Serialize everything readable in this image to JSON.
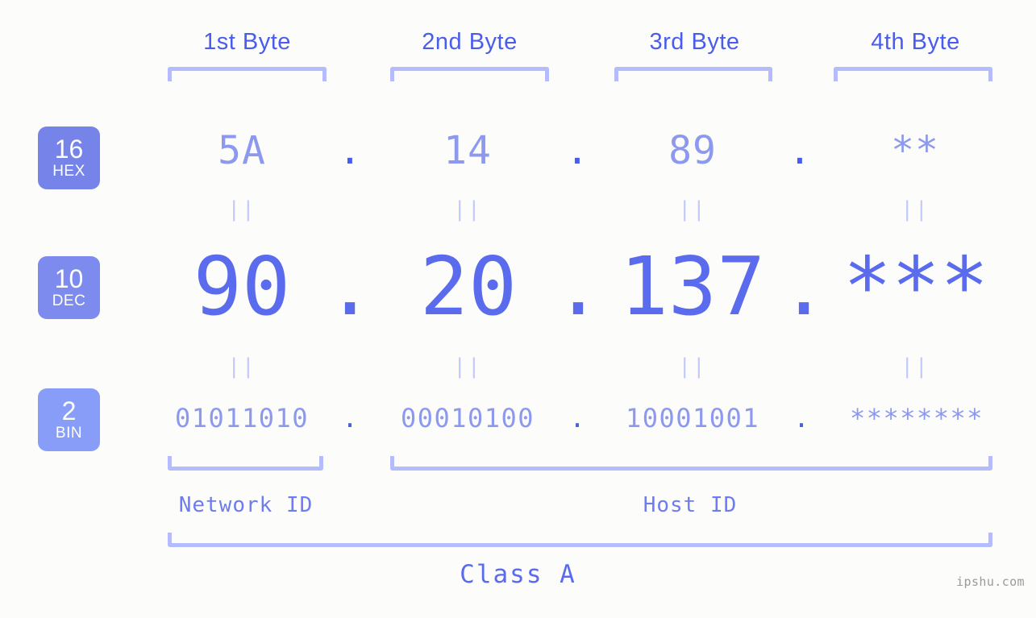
{
  "page": {
    "background_color": "#fcfdfa",
    "accent_color": "#5a6bed",
    "light_accent_color": "#b4bcfb",
    "watermark": "ipshu.com"
  },
  "byte_headers": [
    {
      "label": "1st Byte"
    },
    {
      "label": "2nd Byte"
    },
    {
      "label": "3rd Byte"
    },
    {
      "label": "4th Byte"
    }
  ],
  "radix_badges": [
    {
      "number": "16",
      "name": "HEX",
      "color": "#7683e9"
    },
    {
      "number": "10",
      "name": "DEC",
      "color": "#7e8bee"
    },
    {
      "number": "2",
      "name": "BIN",
      "color": "#879df7"
    }
  ],
  "rows": {
    "hex": {
      "values": [
        "5A",
        "14",
        "89",
        "**"
      ],
      "separators": [
        ".",
        ".",
        "."
      ]
    },
    "dec": {
      "values": [
        "90",
        "20",
        "137",
        "***"
      ],
      "separators": [
        ".",
        ".",
        "."
      ]
    },
    "bin": {
      "values": [
        "01011010",
        "00010100",
        "10001001",
        "********"
      ],
      "separators": [
        ".",
        ".",
        "."
      ]
    }
  },
  "equality_marks": {
    "hex_to_dec": [
      "||",
      "||",
      "||",
      "||"
    ],
    "dec_to_bin": [
      "||",
      "||",
      "||",
      "||"
    ]
  },
  "id_sections": [
    {
      "label": "Network ID"
    },
    {
      "label": "Host ID"
    }
  ],
  "class": {
    "label": "Class A"
  }
}
